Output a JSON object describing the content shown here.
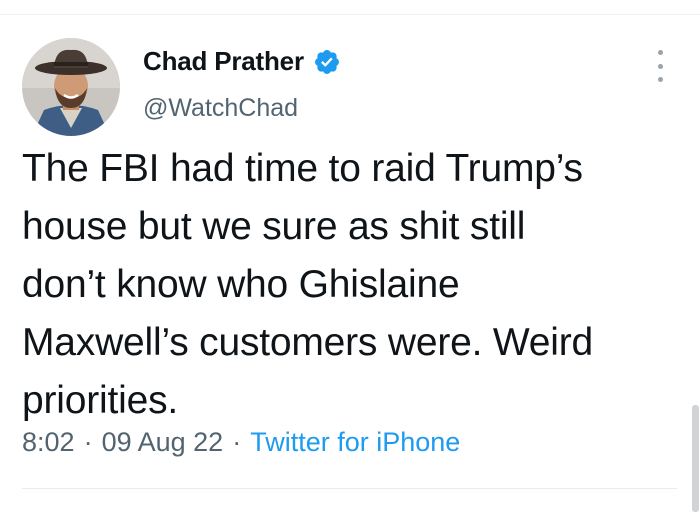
{
  "tweet": {
    "author": {
      "display_name": "Chad Prather",
      "handle": "@WatchChad",
      "verified_icon": "verified-badge-icon",
      "avatar_icon": "profile-photo"
    },
    "text_lines": [
      "The FBI had time to raid Trump’s",
      "house but we sure as shit still",
      "don’t know who Ghislaine",
      "Maxwell’s customers were. Weird",
      "priorities."
    ],
    "time": "8:02",
    "separator": "·",
    "date": "09 Aug 22",
    "source": "Twitter for iPhone",
    "more_icon": "more-options-icon"
  },
  "colors": {
    "text": "#0f1419",
    "secondary": "#536471",
    "link": "#1d9bf0",
    "verified": "#1d9bf0"
  }
}
